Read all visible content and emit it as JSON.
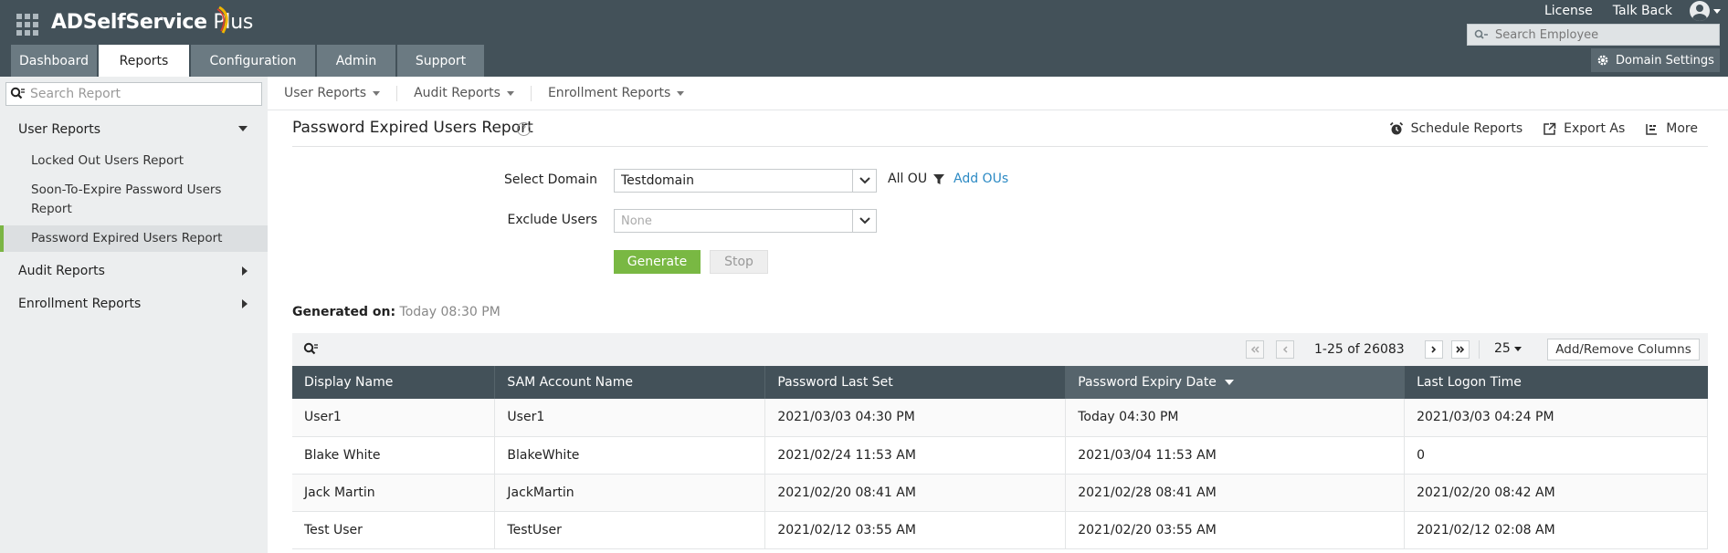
{
  "header": {
    "logo_main": "ADSelfService",
    "logo_plus": " Plus",
    "top_links": [
      "License",
      "Talk Back"
    ],
    "search_placeholder": "Search Employee",
    "domain_settings_label": "Domain Settings",
    "tabs": [
      {
        "label": "Dashboard",
        "active": false
      },
      {
        "label": "Reports",
        "active": true
      },
      {
        "label": "Configuration",
        "active": false
      },
      {
        "label": "Admin",
        "active": false
      },
      {
        "label": "Support",
        "active": false
      }
    ]
  },
  "sidebar": {
    "search_placeholder": "Search Report",
    "categories": [
      {
        "label": "User Reports",
        "expanded": true
      },
      {
        "label": "Audit Reports",
        "expanded": false
      },
      {
        "label": "Enrollment Reports",
        "expanded": false
      }
    ],
    "user_report_items": [
      {
        "label": "Locked Out Users Report",
        "active": false
      },
      {
        "label": "Soon-To-Expire Password Users Report",
        "active": false
      },
      {
        "label": "Password Expired Users Report",
        "active": true
      }
    ]
  },
  "subnav": {
    "items": [
      "User Reports",
      "Audit Reports",
      "Enrollment Reports"
    ]
  },
  "page": {
    "title": "Password Expired Users Report",
    "help": "?",
    "actions": [
      "Schedule Reports",
      "Export As",
      "More"
    ]
  },
  "form": {
    "select_domain_label": "Select Domain",
    "select_domain_value": "Testdomain",
    "all_ou": "All OU",
    "add_ous": "Add OUs",
    "exclude_users_label": "Exclude Users",
    "exclude_users_placeholder": "None",
    "generate_label": "Generate",
    "stop_label": "Stop"
  },
  "generated": {
    "label": "Generated on:",
    "value": "Today 08:30 PM"
  },
  "pagination": {
    "range": "1-25 of 26083",
    "per_page": "25",
    "add_remove_columns": "Add/Remove Columns"
  },
  "table": {
    "columns": [
      "Display Name",
      "SAM Account Name",
      "Password Last Set",
      "Password Expiry Date",
      "Last Logon Time"
    ],
    "sorted_column": "Password Expiry Date",
    "rows": [
      [
        "User1",
        "User1",
        "2021/03/03 04:30 PM",
        "Today 04:30 PM",
        "2021/03/03 04:24 PM"
      ],
      [
        "Blake White",
        "BlakeWhite",
        "2021/02/24 11:53 AM",
        "2021/03/04 11:53 AM",
        "0"
      ],
      [
        "Jack Martin",
        "JackMartin",
        "2021/02/20 08:41 AM",
        "2021/02/28 08:41 AM",
        "2021/02/20 08:42 AM"
      ],
      [
        "Test User",
        "TestUser",
        "2021/02/12 03:55 AM",
        "2021/02/20 03:55 AM",
        "2021/02/12 02:08 AM"
      ]
    ]
  },
  "colors": {
    "header_bg": "#435159",
    "accent_green": "#79b843",
    "link_blue": "#2c8ac4",
    "sidebar_bg": "#eceeef"
  },
  "icons": [
    "apps-grid-icon",
    "logo-swoosh-icon",
    "user-avatar-icon",
    "search-icon",
    "gear-icon",
    "help-icon",
    "alarm-clock-icon",
    "export-icon",
    "more-icon",
    "filter-icon",
    "chevron-down-icon",
    "first-page-icon",
    "prev-page-icon",
    "next-page-icon",
    "last-page-icon",
    "sort-desc-icon"
  ]
}
